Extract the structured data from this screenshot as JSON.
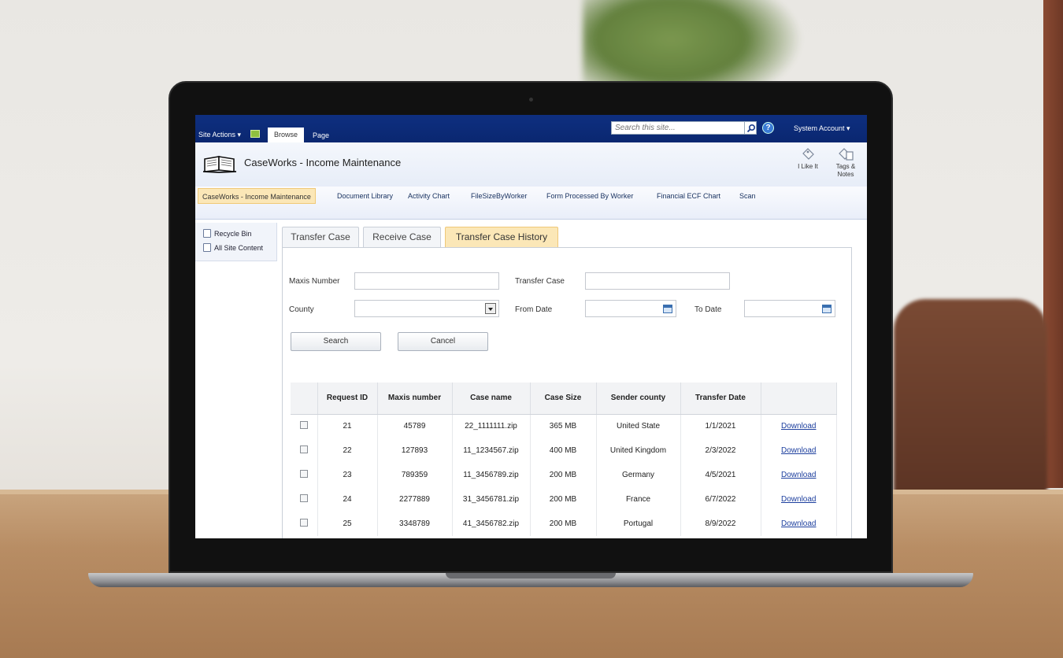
{
  "ribbon": {
    "site_actions": "Site Actions ▾",
    "tab_browse": "Browse",
    "tab_page": "Page",
    "search_placeholder": "Search this site...",
    "account": "System Account ▾",
    "help": "?"
  },
  "header": {
    "site_title": "CaseWorks - Income Maintenance",
    "like_label": "I Like It",
    "tags_label": "Tags &",
    "notes_label": "Notes"
  },
  "topnav": {
    "items": [
      "CaseWorks - Income Maintenance",
      "Document Library",
      "Activity Chart",
      "FileSizeByWorker",
      "Form Processed By Worker",
      "Financial ECF Chart",
      "Scan"
    ]
  },
  "leftnav": {
    "items": [
      "Recycle Bin",
      "All Site Content"
    ]
  },
  "tabs": [
    "Transfer Case",
    "Receive Case",
    "Transfer Case History"
  ],
  "form": {
    "maxis_label": "Maxis Number",
    "transfer_case_label": "Transfer Case",
    "county_label": "County",
    "from_date_label": "From Date",
    "to_date_label": "To Date",
    "search_button": "Search",
    "cancel_button": "Cancel"
  },
  "table": {
    "columns": [
      "Request ID",
      "Maxis number",
      "Case name",
      "Case Size",
      "Sender county",
      "Transfer Date"
    ],
    "rows": [
      {
        "id": "21",
        "maxis": "45789",
        "name": "22_1111111.zip",
        "size": "365 MB",
        "county": "United State",
        "date": "1/1/2021",
        "action": "Download"
      },
      {
        "id": "22",
        "maxis": "127893",
        "name": "11_1234567.zip",
        "size": "400 MB",
        "county": "United Kingdom",
        "date": "2/3/2022",
        "action": "Download"
      },
      {
        "id": "23",
        "maxis": "789359",
        "name": "11_3456789.zip",
        "size": "200 MB",
        "county": "Germany",
        "date": "4/5/2021",
        "action": "Download"
      },
      {
        "id": "24",
        "maxis": "2277889",
        "name": "31_3456781.zip",
        "size": "200 MB",
        "county": "France",
        "date": "6/7/2022",
        "action": "Download"
      },
      {
        "id": "25",
        "maxis": "3348789",
        "name": "41_3456782.zip",
        "size": "200 MB",
        "county": "Portugal",
        "date": "8/9/2022",
        "action": "Download"
      }
    ]
  },
  "colors": {
    "ribbon_blue": "#0e2f80",
    "active_tab": "#fbe7b7",
    "link_blue": "#1d3f9e"
  }
}
